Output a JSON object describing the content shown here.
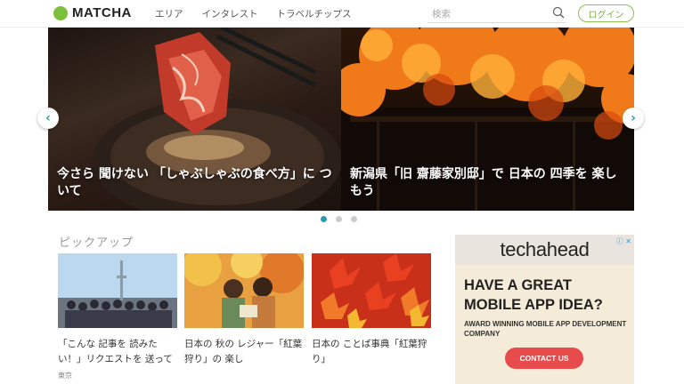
{
  "header": {
    "logo": "MATCHA",
    "nav": [
      "エリア",
      "インタレスト",
      "トラベルチップス"
    ],
    "search_placeholder": "検索",
    "login": "ログイン"
  },
  "carousel": {
    "slides": [
      {
        "title": "今さら 聞けない 「しゃぶしゃぶの食べ方」に ついて"
      },
      {
        "title": "新潟県「旧 齋藤家別邸」で 日本の 四季を 楽しもう"
      }
    ],
    "arrows": {
      "left": "‹",
      "right": "›"
    }
  },
  "pickup": {
    "title": "ピックアップ",
    "cards": [
      {
        "title": "「こんな 記事を 読みたい！」リクエストを 送って",
        "tag": "東京"
      },
      {
        "title": "日本の 秋の レジャー「紅葉狩り」の 楽し",
        "tag": ""
      },
      {
        "title": "日本の ことば事典「紅葉狩り」",
        "tag": ""
      }
    ]
  },
  "ad": {
    "brand": "techahead",
    "choices": "ⓘ ✕",
    "headline_1": "HAVE A GREAT",
    "headline_2": "MOBILE APP IDEA?",
    "sub": "AWARD WINNING MOBILE APP DEVELOPMENT COMPANY",
    "cta": "CONTACT US"
  },
  "colors": {
    "brand_green": "#7cbf3a",
    "accent_teal": "#2a9bb0",
    "ad_button": "#e84b4b"
  }
}
